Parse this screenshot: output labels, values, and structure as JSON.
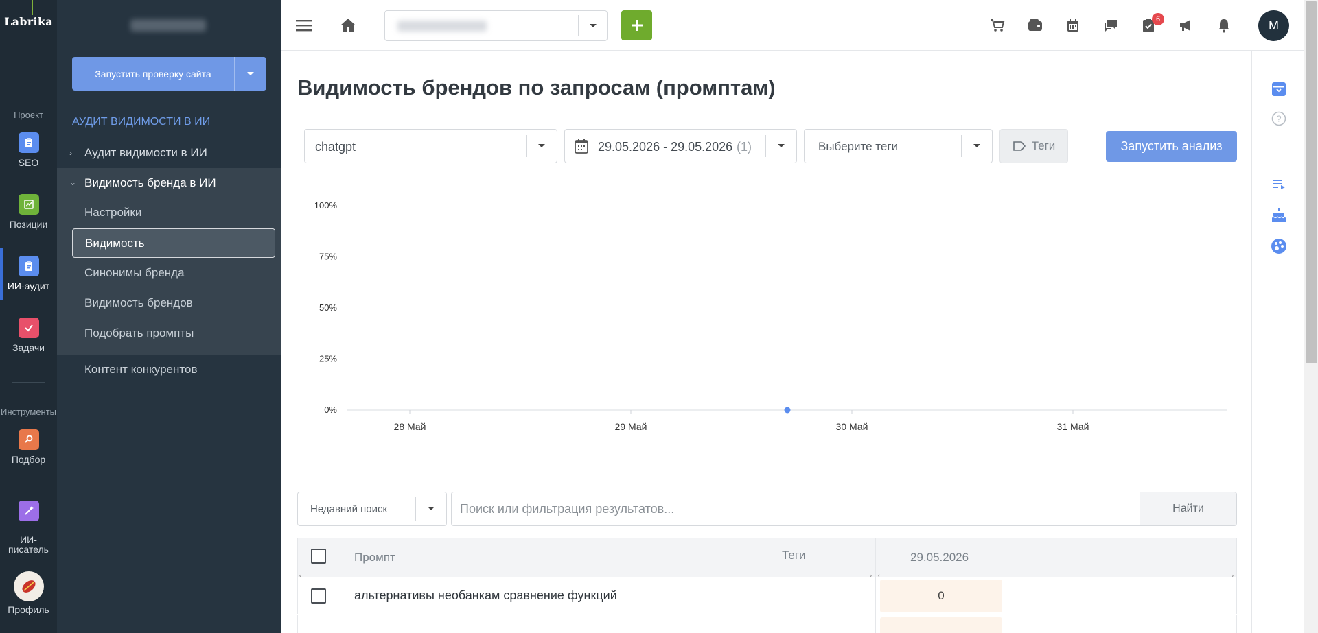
{
  "rail": {
    "logo": "Labrika",
    "section_project": "Проект",
    "section_tools": "Инструменты",
    "items": [
      {
        "label": "SEO",
        "color": "#5b8def"
      },
      {
        "label": "Позиции",
        "color": "#6fb33a"
      },
      {
        "label": "ИИ-аудит",
        "color": "#5b8def"
      },
      {
        "label": "Задачи",
        "color": "#e8506a"
      },
      {
        "label": "Подбор",
        "color": "#e8784a"
      },
      {
        "label": "ИИ-\nписатель",
        "color": "#9c6ee8"
      },
      {
        "label": "Профиль",
        "color": "#f2ede6"
      }
    ]
  },
  "sidebar": {
    "run_check_label": "Запустить проверку сайта",
    "group_title": "АУДИТ ВИДИМОСТИ В ИИ",
    "nav_audit": "Аудит видимости в ИИ",
    "nav_brand_visibility": "Видимость бренда в ИИ",
    "sub_items": [
      "Настройки",
      "Видимость",
      "Синонимы бренда",
      "Видимость брендов",
      "Подобрать промпты"
    ],
    "nav_competitor_content": "Контент конкурентов"
  },
  "topbar": {
    "notifications_count": "6",
    "avatar_letter": "M"
  },
  "main": {
    "title": "Видимость брендов по запросам (промптам)",
    "model_select": "chatgpt",
    "date_range": "29.05.2026 - 29.05.2026",
    "date_count": "(1)",
    "tags_placeholder": "Выберите теги",
    "tags_button": "Теги",
    "run_analysis": "Запустить анализ"
  },
  "chart_data": {
    "type": "line",
    "title": "",
    "xlabel": "",
    "ylabel": "",
    "y_ticks": [
      "100%",
      "75%",
      "50%",
      "25%",
      "0%"
    ],
    "ylim": [
      0,
      100
    ],
    "x_ticks": [
      "28 Май",
      "29 Май",
      "30 Май",
      "31 Май"
    ],
    "grid": false,
    "series": [
      {
        "points": [
          {
            "x": "29.05.2026",
            "y": 0
          }
        ],
        "color": "#5b8def"
      }
    ]
  },
  "search": {
    "recent_label": "Недавний поиск",
    "placeholder": "Поиск или фильтрация результатов...",
    "find_button": "Найти"
  },
  "table": {
    "col_prompt": "Промпт",
    "col_tags": "Теги",
    "col_date": "29.05.2026",
    "rows": [
      {
        "prompt": "альтернативы необанкам сравнение функций",
        "value": "0"
      }
    ]
  }
}
